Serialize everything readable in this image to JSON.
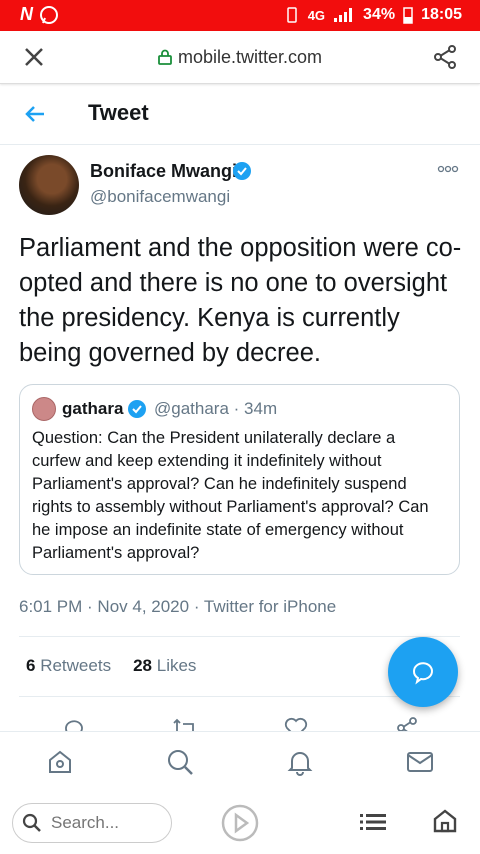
{
  "status_bar": {
    "network": "4G",
    "battery": "34%",
    "time": "18:05"
  },
  "browser": {
    "url": "mobile.twitter.com"
  },
  "header": {
    "title": "Tweet"
  },
  "tweet": {
    "author_name": "Boniface Mwangi",
    "author_handle": "@bonifacemwangi",
    "text": "Parliament and the opposition were co-opted and there is no one to oversight the presidency. Kenya is currently being governed by decree.",
    "time": "6:01 PM",
    "date": "Nov 4, 2020",
    "source": "Twitter for iPhone",
    "retweets_count": "6",
    "retweets_label": "Retweets",
    "likes_count": "28",
    "likes_label": "Likes"
  },
  "quoted": {
    "name": "gathara",
    "handle": "@gathara",
    "age": "34m",
    "text": "Question: Can the President unilaterally declare a curfew and keep extending it indefinitely without Parliament's approval? Can he indefinitely suspend rights to assembly without Parliament's approval? Can he impose an indefinite state of emergency without Parliament's approval?"
  },
  "search": {
    "placeholder": "Search..."
  },
  "colors": {
    "accent": "#1da1f2",
    "status_bar": "#f20d0d",
    "muted": "#657786"
  }
}
